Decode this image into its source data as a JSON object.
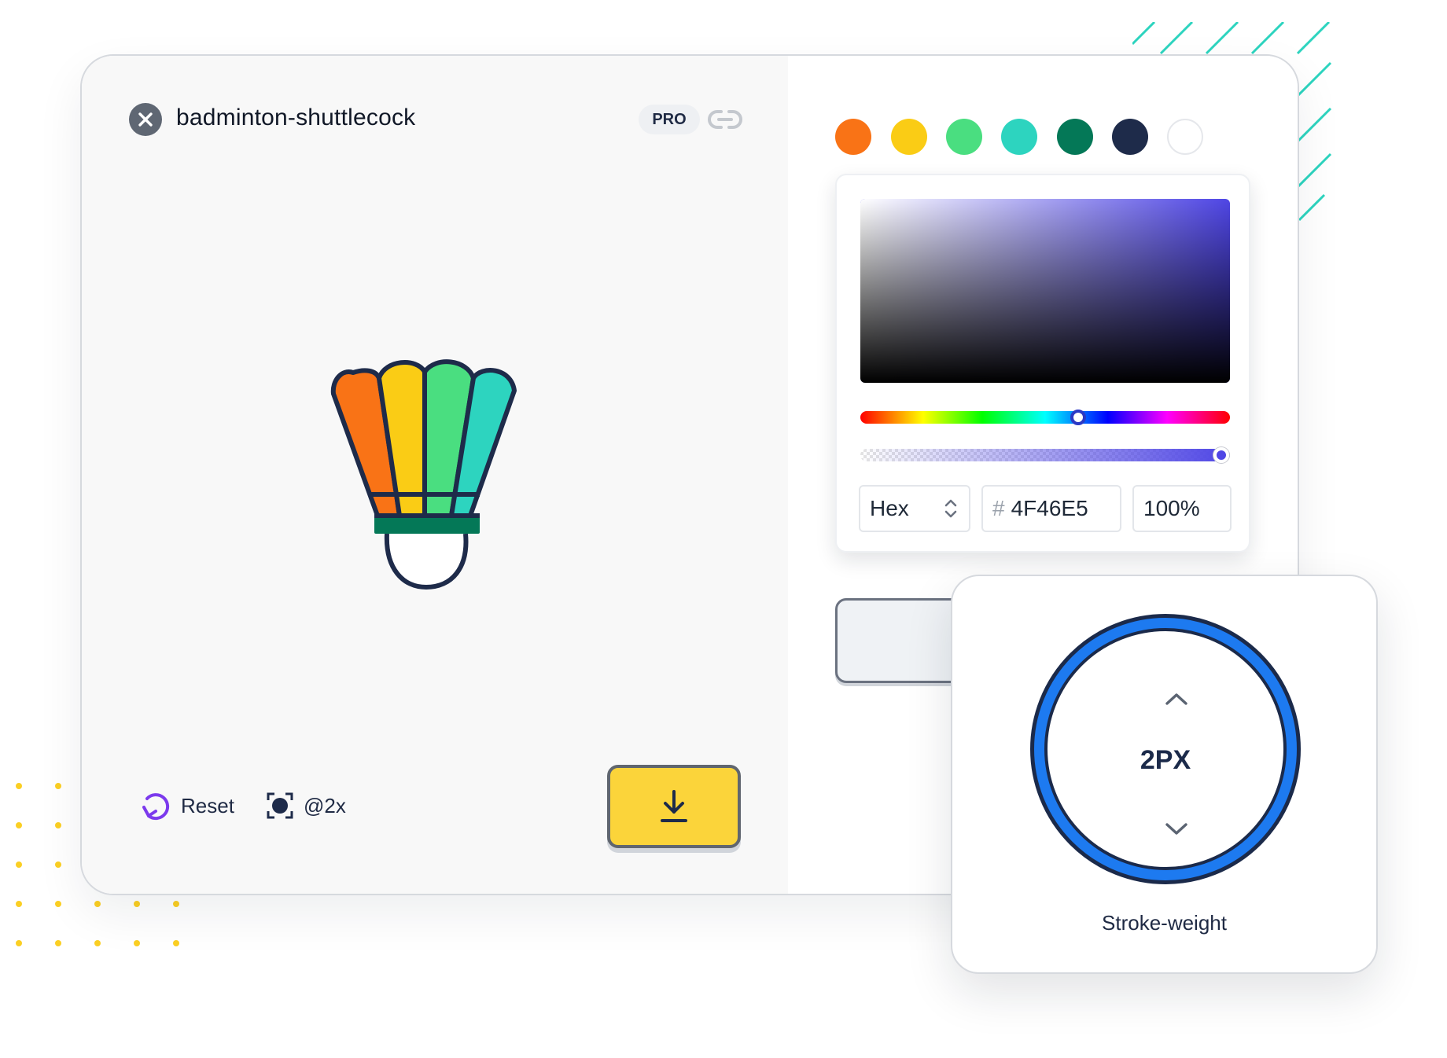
{
  "icon": {
    "title": "badminton-shuttlecock",
    "badge": "PRO",
    "close_icon": "close-icon",
    "link_icon": "link-icon",
    "preview_icon": "badminton-shuttlecock-icon"
  },
  "actions": {
    "reset_label": "Reset",
    "reset_icon": "reset-icon",
    "scale_label": "@2x",
    "scale_icon": "scale-icon",
    "download_icon": "download-icon"
  },
  "swatches": [
    {
      "name": "orange",
      "color": "#f97316"
    },
    {
      "name": "yellow",
      "color": "#facc15"
    },
    {
      "name": "green",
      "color": "#4ade80"
    },
    {
      "name": "teal",
      "color": "#2dd4bf"
    },
    {
      "name": "dark-green",
      "color": "#047857"
    },
    {
      "name": "navy",
      "color": "#1e2b4a"
    },
    {
      "name": "white",
      "color": "#ffffff"
    }
  ],
  "color_picker": {
    "mode": "Hex",
    "mode_icon": "chevron-up-down-icon",
    "hex_prefix": "#",
    "hex_value": "4F46E5",
    "alpha_value": "100%",
    "hue_color": "#4f46e5"
  },
  "stroke": {
    "value": "2PX",
    "label": "Stroke-weight",
    "up_icon": "chevron-up-icon",
    "down_icon": "chevron-down-icon",
    "ring_color": "#1d7af0"
  },
  "colors": {
    "download_button": "#fbd43a",
    "accent": "#4f46e5",
    "decor_stripes": "#2dd4bf",
    "decor_dots": "#fbcf23"
  }
}
